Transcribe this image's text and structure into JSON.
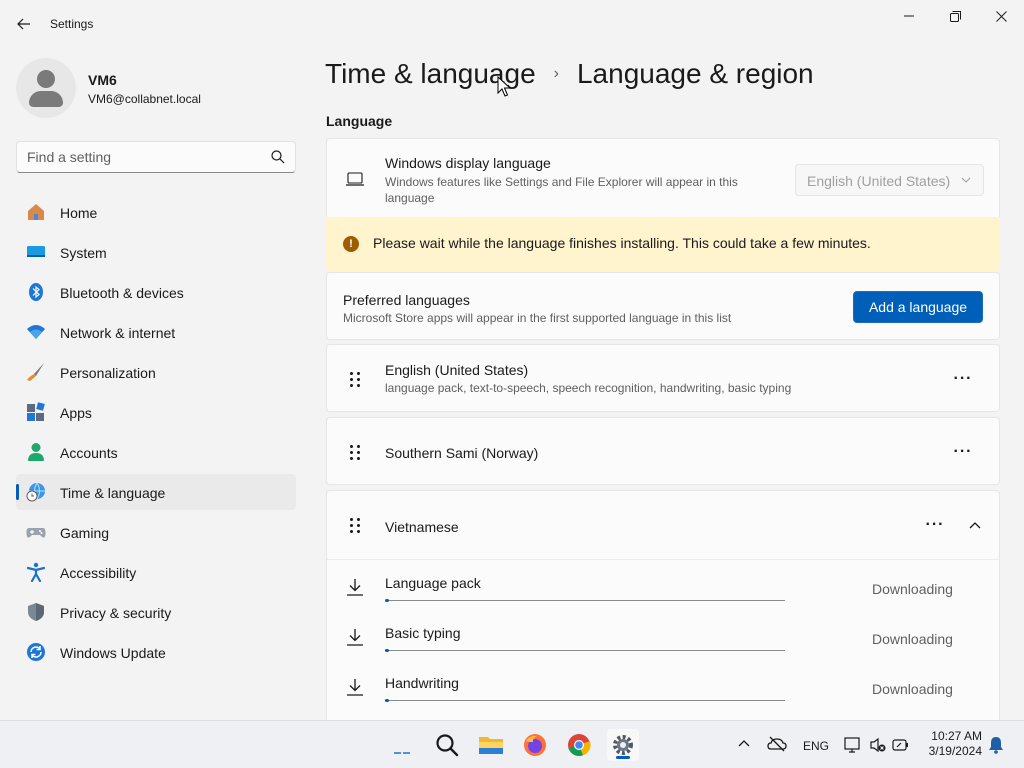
{
  "window": {
    "title": "Settings",
    "controls": {
      "minimize": "minimize",
      "maximize": "maximize",
      "close": "close"
    }
  },
  "profile": {
    "name": "VM6",
    "email": "VM6@collabnet.local"
  },
  "search": {
    "placeholder": "Find a setting",
    "value": ""
  },
  "nav": {
    "items": [
      {
        "label": "Home",
        "icon": "home-icon"
      },
      {
        "label": "System",
        "icon": "system-icon"
      },
      {
        "label": "Bluetooth & devices",
        "icon": "bluetooth-icon"
      },
      {
        "label": "Network & internet",
        "icon": "wifi-icon"
      },
      {
        "label": "Personalization",
        "icon": "brush-icon"
      },
      {
        "label": "Apps",
        "icon": "apps-icon"
      },
      {
        "label": "Accounts",
        "icon": "accounts-icon"
      },
      {
        "label": "Time & language",
        "icon": "time-language-icon",
        "selected": true
      },
      {
        "label": "Gaming",
        "icon": "gaming-icon"
      },
      {
        "label": "Accessibility",
        "icon": "accessibility-icon"
      },
      {
        "label": "Privacy & security",
        "icon": "shield-icon"
      },
      {
        "label": "Windows Update",
        "icon": "update-icon"
      }
    ]
  },
  "breadcrumb": {
    "parent": "Time & language",
    "separator": "›",
    "current": "Language & region"
  },
  "language_section": {
    "title": "Language",
    "display_language": {
      "title": "Windows display language",
      "description": "Windows features like Settings and File Explorer will appear in this language",
      "selected": "English (United States)"
    },
    "warning": {
      "icon": "!",
      "text": "Please wait while the language finishes installing. This could take a few minutes."
    },
    "preferred": {
      "title": "Preferred languages",
      "description": "Microsoft Store apps will appear in the first supported language in this list",
      "add_button": "Add a language"
    },
    "languages": [
      {
        "name": "English (United States)",
        "features": "language pack, text-to-speech, speech recognition, handwriting, basic typing"
      },
      {
        "name": "Southern Sami (Norway)",
        "features": ""
      },
      {
        "name": "Vietnamese",
        "features": "",
        "expanded": true
      }
    ],
    "more_label": "···",
    "downloads": [
      {
        "label": "Language pack",
        "status": "Downloading",
        "progress": 0.01
      },
      {
        "label": "Basic typing",
        "status": "Downloading",
        "progress": 0.01
      },
      {
        "label": "Handwriting",
        "status": "Downloading",
        "progress": 0.01
      }
    ]
  },
  "taskbar": {
    "language": "ENG",
    "time": "10:27 AM",
    "date": "3/19/2024"
  },
  "colors": {
    "accent": "#005fb8",
    "warning_bg": "#fff4ce",
    "warning_icon": "#9d5d00"
  }
}
